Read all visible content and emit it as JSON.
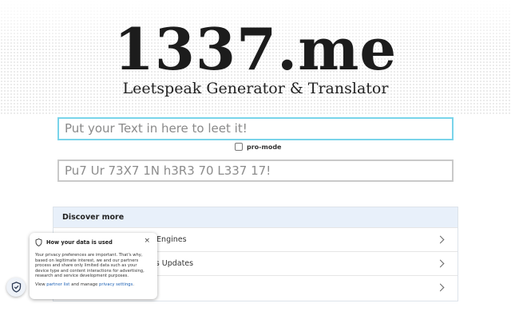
{
  "header": {
    "logo": "1337.me",
    "subtitle": "Leetspeak Generator & Translator"
  },
  "translator": {
    "input_placeholder": "Put your Text in here to leet it!",
    "promode_label": "pro-mode",
    "promode_checked": false,
    "output_placeholder": "Pu7 Ur 73X7 1N h3R3 70 L337 17!"
  },
  "discover": {
    "title": "Discover more",
    "items": [
      {
        "label": "h Engines"
      },
      {
        "label": "ws Updates"
      },
      {
        "label": ""
      }
    ]
  },
  "privacy": {
    "title": "How your data is used",
    "body": "Your privacy preferences are important. That's why, based on legitimate interest, we and our partners process and share only limited data such as your device type and content interactions for advertising, research and service development purposes.",
    "footer_prefix": "View ",
    "partner_link": "partner list",
    "footer_middle": " and manage ",
    "settings_link": "privacy settings",
    "footer_suffix": ".",
    "close": "×"
  },
  "colors": {
    "input_focus_border": "#79d4ea",
    "discover_header_bg": "#e8f0fa",
    "link": "#1a5fb4"
  },
  "icons": {
    "popup": "shield-icon",
    "badge": "shield-check-icon",
    "row": "chevron-right-icon"
  }
}
